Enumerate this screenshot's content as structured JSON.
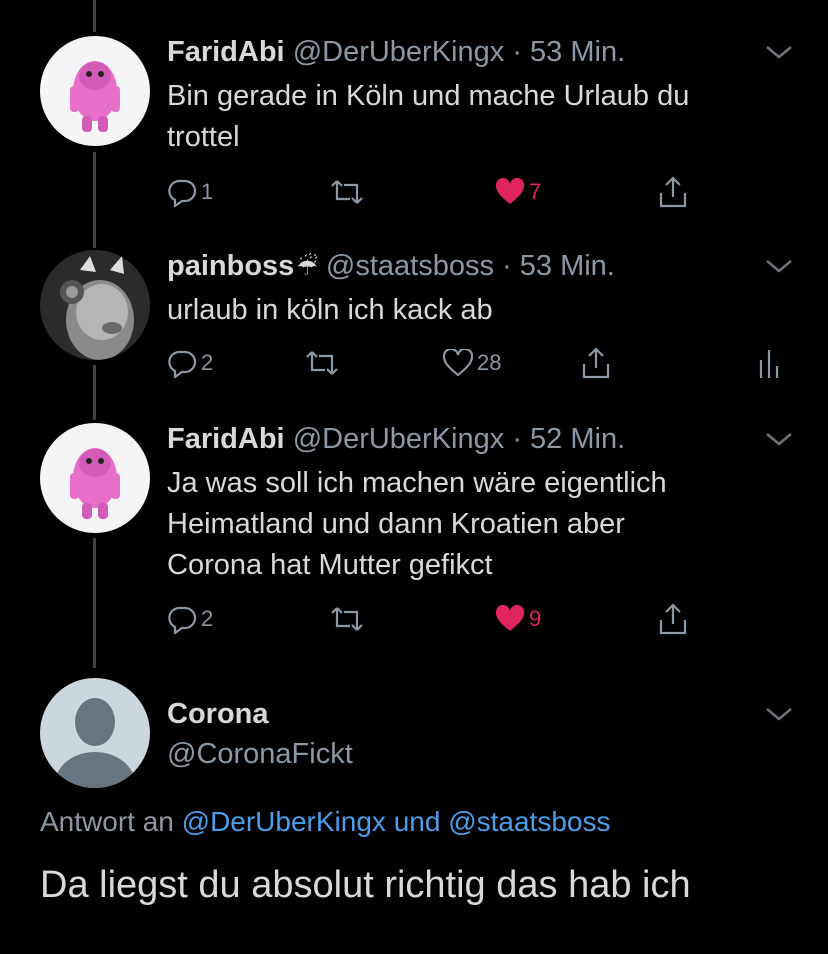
{
  "tweets": [
    {
      "name": "FaridAbi",
      "handle": "@DerUberKingx",
      "time": "53 Min.",
      "text_lines": [
        "Bin gerade in Köln und mache Urlaub du",
        "trottel"
      ],
      "replies": "1",
      "retweets": "",
      "likes": "7",
      "liked": true
    },
    {
      "name": "painboss",
      "name_emoji": "☔",
      "handle": "@staatsboss",
      "time": "53 Min.",
      "text_lines": [
        "urlaub in köln ich kack ab"
      ],
      "replies": "2",
      "retweets": "",
      "likes": "28",
      "liked": false
    },
    {
      "name": "FaridAbi",
      "handle": "@DerUberKingx",
      "time": "52 Min.",
      "text_lines": [
        "Ja was soll ich machen wäre eigentlich",
        "Heimatland und dann Kroatien aber",
        "Corona hat Mutter gefikct"
      ],
      "replies": "2",
      "retweets": "",
      "likes": "9",
      "liked": true
    }
  ],
  "focus": {
    "name": "Corona",
    "handle": "@CoronaFickt",
    "reply_prefix": "Antwort an",
    "reply_users": "@DerUberKingx und @staatsboss",
    "text": "Da liegst du absolut richtig das hab ich"
  },
  "icons": {
    "reply": "reply-icon",
    "retweet": "retweet-icon",
    "like": "heart-icon",
    "share": "share-icon",
    "analytics": "analytics-icon",
    "more": "chevron-down-icon"
  },
  "colors": {
    "background": "#000000",
    "text": "#d9d9d9",
    "muted": "#8b98a5",
    "like": "#e0245e",
    "link": "#4a9eea",
    "thread_line": "#3d4247"
  }
}
